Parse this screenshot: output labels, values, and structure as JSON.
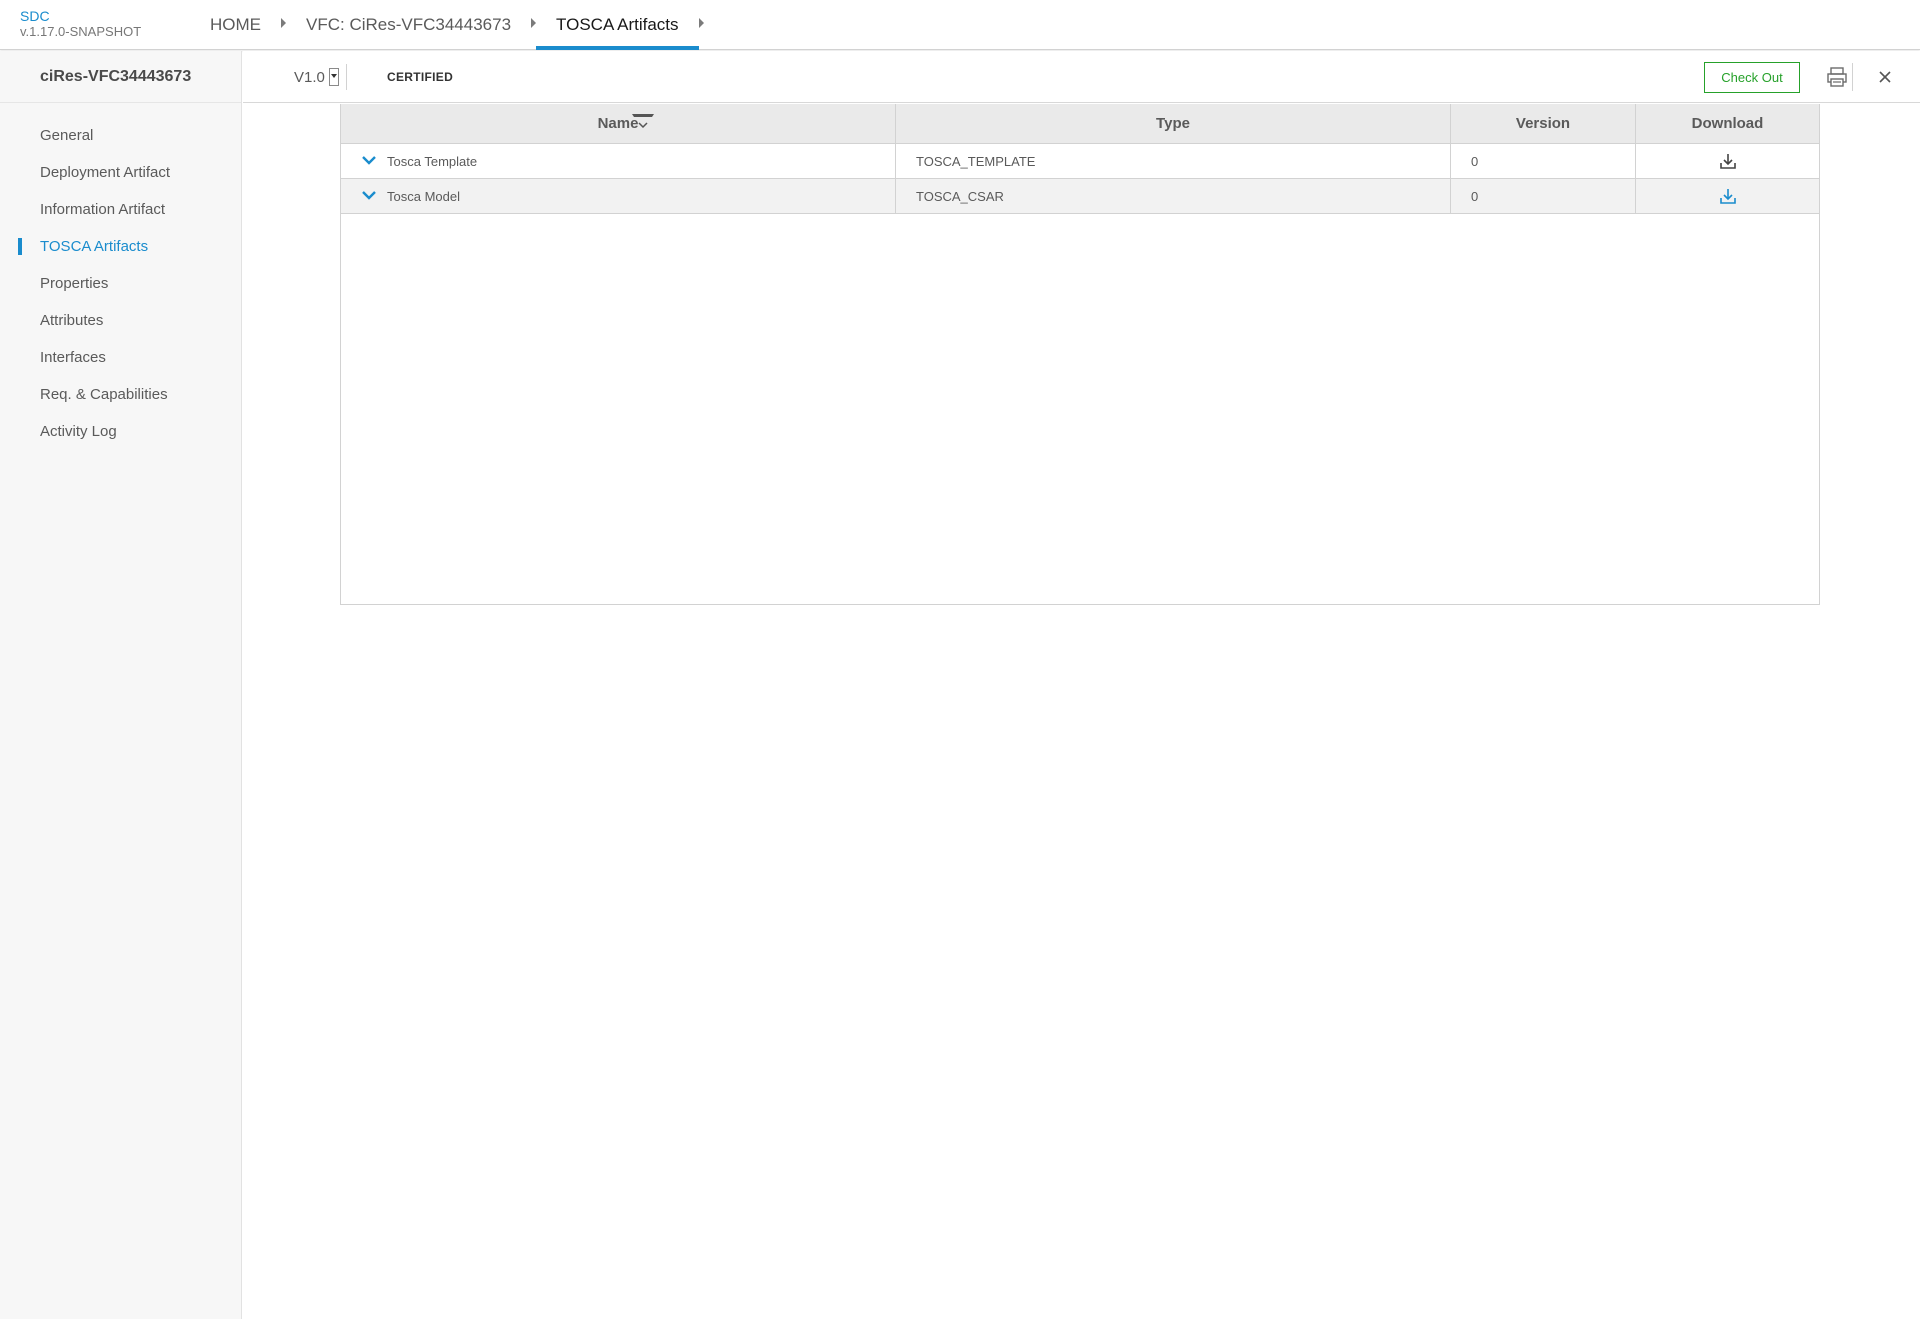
{
  "app": {
    "name": "SDC",
    "version": "v.1.17.0-SNAPSHOT"
  },
  "breadcrumb": [
    {
      "label": "HOME"
    },
    {
      "label": "VFC: CiRes-VFC34443673"
    },
    {
      "label": "TOSCA Artifacts",
      "active": true
    }
  ],
  "sidebar": {
    "title": "ciRes-VFC34443673",
    "items": [
      {
        "label": "General"
      },
      {
        "label": "Deployment Artifact"
      },
      {
        "label": "Information Artifact"
      },
      {
        "label": "TOSCA Artifacts",
        "active": true
      },
      {
        "label": "Properties"
      },
      {
        "label": "Attributes"
      },
      {
        "label": "Interfaces"
      },
      {
        "label": "Req. & Capabilities"
      },
      {
        "label": "Activity Log"
      }
    ]
  },
  "subheader": {
    "version": "V1.0",
    "status": "CERTIFIED",
    "checkout_label": "Check Out",
    "icons": [
      "printer-icon",
      "close-icon"
    ]
  },
  "table": {
    "columns": [
      "Name",
      "Type",
      "Version",
      "Download"
    ],
    "sort_column": "Name",
    "rows": [
      {
        "name": "Tosca Template",
        "type": "TOSCA_TEMPLATE",
        "version": "0",
        "download_icon": "download-icon"
      },
      {
        "name": "Tosca Model",
        "type": "TOSCA_CSAR",
        "version": "0",
        "download_icon": "download-icon"
      }
    ]
  },
  "colors": {
    "accent": "#1a8ccd",
    "checkout_green": "#26a12a",
    "header_bg": "#eaeaea",
    "sidebar_bg": "#f7f7f7"
  }
}
